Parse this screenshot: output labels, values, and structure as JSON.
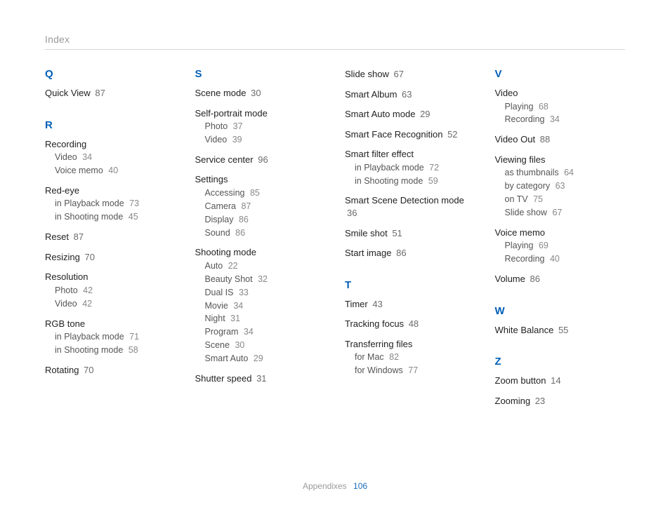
{
  "header": "Index",
  "footer": {
    "label": "Appendixes",
    "page": "106"
  },
  "columns": [
    {
      "sections": [
        {
          "letter": "Q",
          "entries": [
            {
              "label": "Quick View",
              "page": "87"
            }
          ]
        },
        {
          "letter": "R",
          "entries": [
            {
              "label": "Recording",
              "subs": [
                {
                  "term": "Video",
                  "page": "34"
                },
                {
                  "term": "Voice memo",
                  "page": "40"
                }
              ]
            },
            {
              "label": "Red-eye",
              "subs": [
                {
                  "term": "in Playback mode",
                  "page": "73"
                },
                {
                  "term": "in Shooting mode",
                  "page": "45"
                }
              ]
            },
            {
              "label": "Reset",
              "page": "87"
            },
            {
              "label": "Resizing",
              "page": "70"
            },
            {
              "label": "Resolution",
              "subs": [
                {
                  "term": "Photo",
                  "page": "42"
                },
                {
                  "term": "Video",
                  "page": "42"
                }
              ]
            },
            {
              "label": "RGB tone",
              "subs": [
                {
                  "term": "in Playback mode",
                  "page": "71"
                },
                {
                  "term": "in Shooting mode",
                  "page": "58"
                }
              ]
            },
            {
              "label": "Rotating",
              "page": "70"
            }
          ]
        }
      ]
    },
    {
      "sections": [
        {
          "letter": "S",
          "entries": [
            {
              "label": "Scene mode",
              "page": "30"
            },
            {
              "label": "Self-portrait mode",
              "subs": [
                {
                  "term": "Photo",
                  "page": "37"
                },
                {
                  "term": "Video",
                  "page": "39"
                }
              ]
            },
            {
              "label": "Service center",
              "page": "96"
            },
            {
              "label": "Settings",
              "subs": [
                {
                  "term": "Accessing",
                  "page": "85"
                },
                {
                  "term": "Camera",
                  "page": "87"
                },
                {
                  "term": "Display",
                  "page": "86"
                },
                {
                  "term": "Sound",
                  "page": "86"
                }
              ]
            },
            {
              "label": "Shooting mode",
              "subs": [
                {
                  "term": "Auto",
                  "page": "22"
                },
                {
                  "term": "Beauty Shot",
                  "page": "32"
                },
                {
                  "term": "Dual IS",
                  "page": "33"
                },
                {
                  "term": "Movie",
                  "page": "34"
                },
                {
                  "term": "Night",
                  "page": "31"
                },
                {
                  "term": "Program",
                  "page": "34"
                },
                {
                  "term": "Scene",
                  "page": "30"
                },
                {
                  "term": "Smart Auto",
                  "page": "29"
                }
              ]
            },
            {
              "label": "Shutter speed",
              "page": "31"
            }
          ]
        }
      ]
    },
    {
      "sections": [
        {
          "entries": [
            {
              "label": "Slide show",
              "page": "67"
            },
            {
              "label": "Smart Album",
              "page": "63"
            },
            {
              "label": "Smart Auto mode",
              "page": "29"
            },
            {
              "label": "Smart Face Recognition",
              "page": "52"
            },
            {
              "label": "Smart filter effect",
              "subs": [
                {
                  "term": "in Playback mode",
                  "page": "72"
                },
                {
                  "term": "in Shooting mode",
                  "page": "59"
                }
              ]
            },
            {
              "label": "Smart Scene Detection mode",
              "page": "36"
            },
            {
              "label": "Smile shot",
              "page": "51"
            },
            {
              "label": "Start image",
              "page": "86"
            }
          ]
        },
        {
          "letter": "T",
          "entries": [
            {
              "label": "Timer",
              "page": "43"
            },
            {
              "label": "Tracking focus",
              "page": "48"
            },
            {
              "label": "Transferring files",
              "subs": [
                {
                  "term": "for Mac",
                  "page": "82"
                },
                {
                  "term": "for Windows",
                  "page": "77"
                }
              ]
            }
          ]
        }
      ]
    },
    {
      "sections": [
        {
          "letter": "V",
          "entries": [
            {
              "label": "Video",
              "subs": [
                {
                  "term": "Playing",
                  "page": "68"
                },
                {
                  "term": "Recording",
                  "page": "34"
                }
              ]
            },
            {
              "label": "Video Out",
              "page": "88"
            },
            {
              "label": "Viewing files",
              "subs": [
                {
                  "term": "as thumbnails",
                  "page": "64"
                },
                {
                  "term": "by category",
                  "page": "63"
                },
                {
                  "term": "on TV",
                  "page": "75"
                },
                {
                  "term": "Slide show",
                  "page": "67"
                }
              ]
            },
            {
              "label": "Voice memo",
              "subs": [
                {
                  "term": "Playing",
                  "page": "69"
                },
                {
                  "term": "Recording",
                  "page": "40"
                }
              ]
            },
            {
              "label": "Volume",
              "page": "86"
            }
          ]
        },
        {
          "letter": "W",
          "entries": [
            {
              "label": "White Balance",
              "page": "55"
            }
          ]
        },
        {
          "letter": "Z",
          "entries": [
            {
              "label": "Zoom button",
              "page": "14"
            },
            {
              "label": "Zooming",
              "page": "23"
            }
          ]
        }
      ]
    }
  ]
}
